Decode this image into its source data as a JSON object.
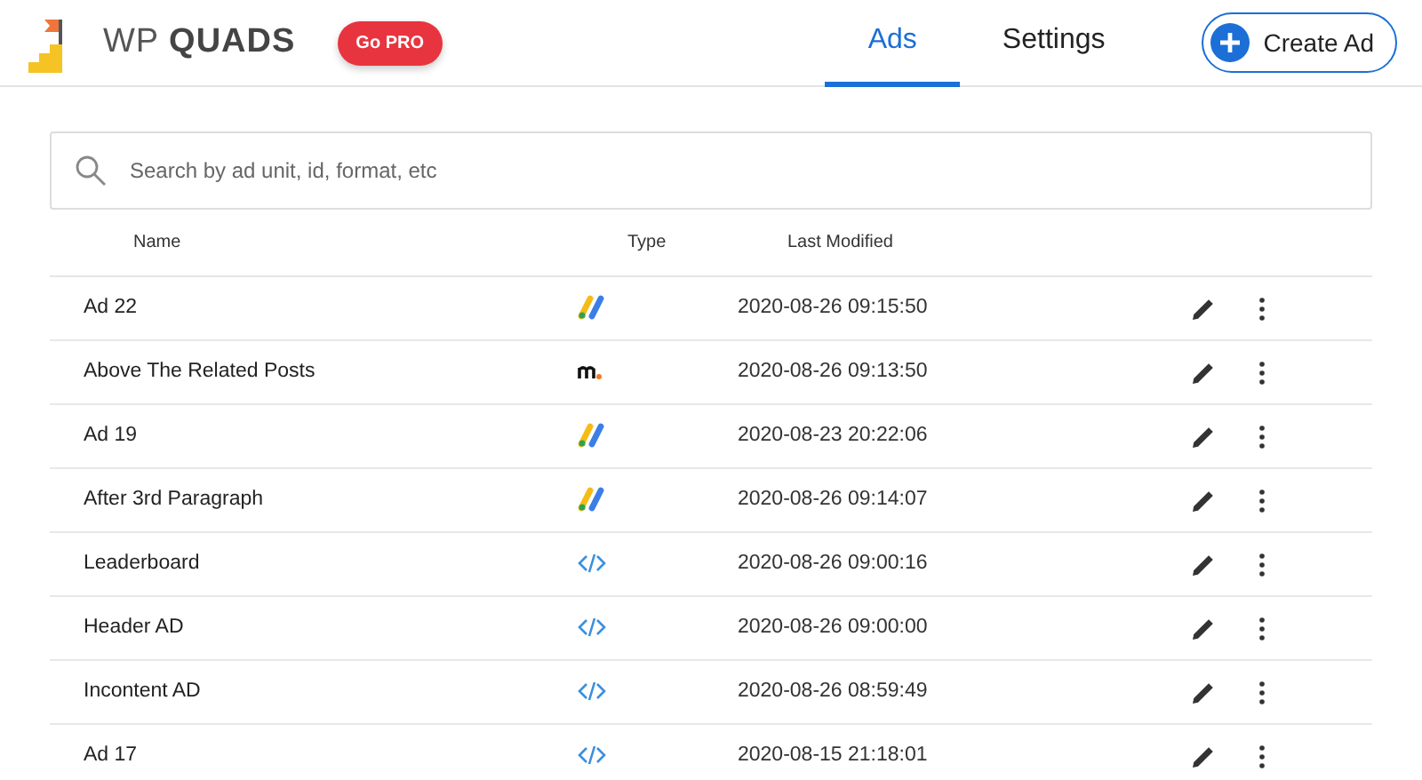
{
  "brand": {
    "name_light": "WP",
    "name_bold": "QUADS",
    "pro_button": "Go PRO"
  },
  "tabs": [
    {
      "label": "Ads",
      "selected": true
    },
    {
      "label": "Settings",
      "selected": false
    }
  ],
  "create_button": "Create Ad",
  "search": {
    "placeholder": "Search by ad unit, id, format, etc"
  },
  "table": {
    "columns": [
      "Name",
      "Type",
      "Last Modified"
    ],
    "rows": [
      {
        "name": "Ad 22",
        "kind": "adsense",
        "modified": "2020-08-26 09:15:50"
      },
      {
        "name": "Above The Related Posts",
        "kind": "medianet",
        "modified": "2020-08-26 09:13:50"
      },
      {
        "name": "Ad 19",
        "kind": "adsense",
        "modified": "2020-08-23 20:22:06"
      },
      {
        "name": "After 3rd Paragraph",
        "kind": "adsense",
        "modified": "2020-08-26 09:14:07"
      },
      {
        "name": "Leaderboard",
        "kind": "code",
        "modified": "2020-08-26 09:00:16"
      },
      {
        "name": "Header AD",
        "kind": "code",
        "modified": "2020-08-26 09:00:00"
      },
      {
        "name": "Incontent AD",
        "kind": "code",
        "modified": "2020-08-26 08:59:49"
      },
      {
        "name": "Ad 17",
        "kind": "code",
        "modified": "2020-08-15 21:18:01"
      }
    ]
  }
}
